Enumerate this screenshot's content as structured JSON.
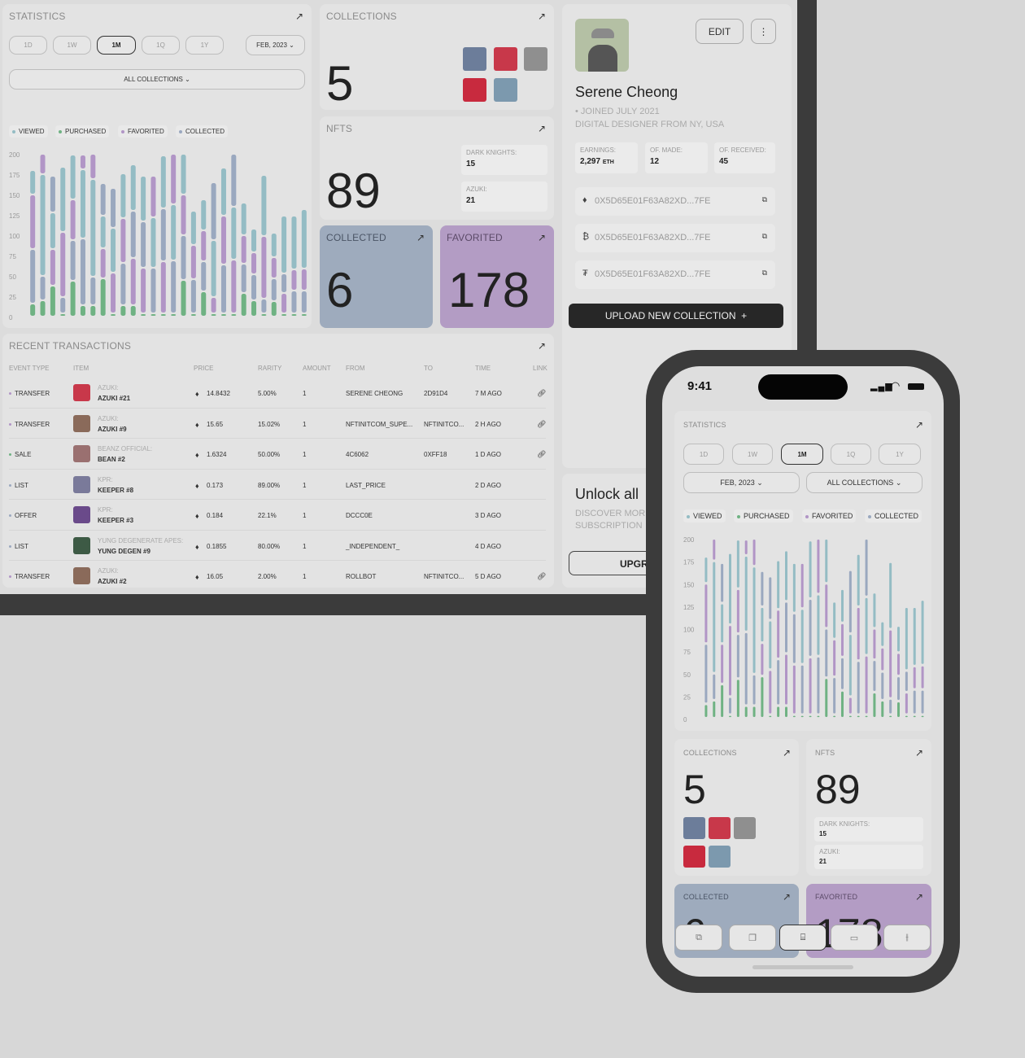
{
  "colors": {
    "viewed": "#94bcc4",
    "purchased": "#6fb283",
    "favorited": "#b195c6",
    "collected": "#9aa8bf",
    "collected_card": "#9eabbd",
    "favorited_card": "#b39cc4"
  },
  "statistics": {
    "title": "STATISTICS",
    "ranges": [
      "1D",
      "1W",
      "1M",
      "1Q",
      "1Y"
    ],
    "selected_range": "1M",
    "month": "FEB, 2023",
    "collection_filter": "ALL COLLECTIONS",
    "legend": [
      "VIEWED",
      "PURCHASED",
      "FAVORITED",
      "COLLECTED"
    ]
  },
  "collections": {
    "title": "COLLECTIONS",
    "count": "5"
  },
  "nfts": {
    "title": "NFTS",
    "count": "89",
    "breakdown": [
      {
        "label": "DARK KNIGHTS:",
        "value": "15"
      },
      {
        "label": "AZUKI:",
        "value": "21"
      }
    ]
  },
  "collected": {
    "title": "COLLECTED",
    "count": "6"
  },
  "favorited": {
    "title": "FAVORITED",
    "count": "178"
  },
  "profile": {
    "name": "Serene Cheong",
    "joined": "JOINED JULY 2021",
    "bio": "DIGITAL DESIGNER FROM NY, USA",
    "edit": "EDIT",
    "more_icon": "⋮",
    "stats": [
      {
        "label": "EARNINGS:",
        "value": "2,297",
        "unit": "ETH"
      },
      {
        "label": "OF. MADE:",
        "value": "12"
      },
      {
        "label": "OF. RECEIVED:",
        "value": "45"
      }
    ],
    "wallets": [
      {
        "icon": "ethereum-icon",
        "glyph": "♦",
        "address": "0X5D65E01F63A82XD...7FE"
      },
      {
        "icon": "bitcoin-icon",
        "glyph": "₿",
        "address": "0X5D65E01F63A82XD...7FE"
      },
      {
        "icon": "tether-icon",
        "glyph": "₮",
        "address": "0X5D65E01F63A82XD...7FE"
      }
    ],
    "upload": "UPLOAD NEW COLLECTION  +"
  },
  "unlock": {
    "title": "Unlock all",
    "text1": "DISCOVER MOR",
    "text2": "SUBSCRIPTION",
    "button": "UPGR"
  },
  "transactions": {
    "title": "RECENT TRANSACTIONS",
    "headers": [
      "EVENT TYPE",
      "ITEM",
      "PRICE",
      "RARITY",
      "AMOUNT",
      "FROM",
      "TO",
      "TIME",
      "LINK"
    ],
    "rows": [
      {
        "event": "TRANSFER",
        "collection": "AZUKI:",
        "item": "AZUKI #21",
        "price": "14.8432",
        "rarity": "5.00%",
        "amount": "1",
        "from": "SERENE CHEONG",
        "to": "2D91D4",
        "time": "7 M AGO",
        "link": true,
        "dot": "#b195c6",
        "thumb": "#c8384a"
      },
      {
        "event": "TRANSFER",
        "collection": "AZUKI:",
        "item": "AZUKI #9",
        "price": "15.65",
        "rarity": "15.02%",
        "amount": "1",
        "from": "NFTINITCOM_SUPE...",
        "to": "NFTINITCO...",
        "time": "2 H AGO",
        "link": true,
        "dot": "#b195c6",
        "thumb": "#8a6a5a"
      },
      {
        "event": "SALE",
        "collection": "BEANZ OFFICIAL:",
        "item": "BEAN #2",
        "price": "1.6324",
        "rarity": "50.00%",
        "amount": "1",
        "from": "4C6062",
        "to": "0XFF18",
        "time": "1 D AGO",
        "link": true,
        "dot": "#6fb283",
        "thumb": "#9a7070"
      },
      {
        "event": "LIST",
        "collection": "KPR:",
        "item": "KEEPER #8",
        "price": "0.173",
        "rarity": "89.00%",
        "amount": "1",
        "from": "LAST_PRICE",
        "to": "",
        "time": "2 D AGO",
        "link": false,
        "dot": "#9aa8bf",
        "thumb": "#7a7a9a"
      },
      {
        "event": "OFFER",
        "collection": "KPR:",
        "item": "KEEPER #3",
        "price": "0.184",
        "rarity": "22.1%",
        "amount": "1",
        "from": "DCCC0E",
        "to": "",
        "time": "3 D AGO",
        "link": false,
        "dot": "#9aa8bf",
        "thumb": "#6a4a8a"
      },
      {
        "event": "LIST",
        "collection": "YUNG DEGENERATE APES:",
        "item": "YUNG DEGEN #9",
        "price": "0.1855",
        "rarity": "80.00%",
        "amount": "1",
        "from": "_INDEPENDENT_",
        "to": "",
        "time": "4 D AGO",
        "link": false,
        "dot": "#9aa8bf",
        "thumb": "#3d5a45"
      },
      {
        "event": "TRANSFER",
        "collection": "AZUKI:",
        "item": "AZUKI #2",
        "price": "16.05",
        "rarity": "2.00%",
        "amount": "1",
        "from": "ROLLBOT",
        "to": "NFTINITCO...",
        "time": "5 D AGO",
        "link": true,
        "dot": "#b195c6",
        "thumb": "#8a6a5a"
      }
    ]
  },
  "phone": {
    "time": "9:41",
    "nav_icons": [
      "cards-icon",
      "copy-icon",
      "store-icon",
      "folder-icon",
      "sliders-icon"
    ],
    "selected_nav": "store-icon"
  },
  "chart_data": {
    "type": "bar",
    "stacked": true,
    "ylim": [
      0,
      200
    ],
    "yticks": [
      0,
      25,
      50,
      75,
      100,
      125,
      150,
      175,
      200
    ],
    "grid": false,
    "legend_position": "top-left",
    "series": [
      "viewed",
      "purchased",
      "favorited",
      "collected"
    ],
    "series_labels": {
      "viewed": "VIEWED",
      "purchased": "PURCHASED",
      "favorited": "FAVORITED",
      "collected": "COLLECTED"
    },
    "stacks": [
      [
        [
          "purchased",
          16
        ],
        [
          "collected",
          67
        ],
        [
          "favorited",
          67
        ],
        [
          "viewed",
          30
        ]
      ],
      [
        [
          "purchased",
          20
        ],
        [
          "collected",
          30
        ],
        [
          "viewed",
          125
        ],
        [
          "favorited",
          25
        ]
      ],
      [
        [
          "purchased",
          38
        ],
        [
          "favorited",
          45
        ],
        [
          "viewed",
          45
        ],
        [
          "collected",
          45
        ]
      ],
      [
        [
          "purchased",
          4
        ],
        [
          "collected",
          20
        ],
        [
          "favorited",
          80
        ],
        [
          "viewed",
          80
        ]
      ],
      [
        [
          "purchased",
          44
        ],
        [
          "collected",
          50
        ],
        [
          "favorited",
          50
        ],
        [
          "viewed",
          55
        ]
      ],
      [
        [
          "purchased",
          14
        ],
        [
          "collected",
          82
        ],
        [
          "viewed",
          85
        ],
        [
          "favorited",
          18
        ]
      ],
      [
        [
          "purchased",
          14
        ],
        [
          "collected",
          35
        ],
        [
          "viewed",
          120
        ],
        [
          "favorited",
          31
        ]
      ],
      [
        [
          "purchased",
          47
        ],
        [
          "favorited",
          37
        ],
        [
          "viewed",
          40
        ],
        [
          "collected",
          40
        ]
      ],
      [
        [
          "purchased",
          4
        ],
        [
          "favorited",
          50
        ],
        [
          "viewed",
          55
        ],
        [
          "collected",
          49
        ]
      ],
      [
        [
          "purchased",
          14
        ],
        [
          "collected",
          52
        ],
        [
          "favorited",
          55
        ],
        [
          "viewed",
          55
        ]
      ],
      [
        [
          "purchased",
          14
        ],
        [
          "favorited",
          58
        ],
        [
          "collected",
          58
        ],
        [
          "viewed",
          57
        ]
      ],
      [
        [
          "purchased",
          4
        ],
        [
          "favorited",
          56
        ],
        [
          "collected",
          57
        ],
        [
          "viewed",
          56
        ]
      ],
      [
        [
          "purchased",
          4
        ],
        [
          "collected",
          56
        ],
        [
          "viewed",
          62
        ],
        [
          "favorited",
          51
        ]
      ],
      [
        [
          "purchased",
          4
        ],
        [
          "favorited",
          64
        ],
        [
          "collected",
          65
        ],
        [
          "viewed",
          65
        ]
      ],
      [
        [
          "purchased",
          4
        ],
        [
          "collected",
          65
        ],
        [
          "viewed",
          69
        ],
        [
          "favorited",
          62
        ]
      ],
      [
        [
          "purchased",
          45
        ],
        [
          "collected",
          55
        ],
        [
          "favorited",
          50
        ],
        [
          "viewed",
          50
        ]
      ],
      [
        [
          "purchased",
          4
        ],
        [
          "collected",
          42
        ],
        [
          "favorited",
          42
        ],
        [
          "viewed",
          42
        ]
      ],
      [
        [
          "purchased",
          31
        ],
        [
          "collected",
          37
        ],
        [
          "favorited",
          38
        ],
        [
          "viewed",
          38
        ]
      ],
      [
        [
          "purchased",
          4
        ],
        [
          "favorited",
          20
        ],
        [
          "viewed",
          70
        ],
        [
          "collected",
          71
        ]
      ],
      [
        [
          "purchased",
          4
        ],
        [
          "collected",
          60
        ],
        [
          "favorited",
          60
        ],
        [
          "viewed",
          59
        ]
      ],
      [
        [
          "purchased",
          4
        ],
        [
          "favorited",
          66
        ],
        [
          "viewed",
          65
        ],
        [
          "collected",
          65
        ]
      ],
      [
        [
          "purchased",
          29
        ],
        [
          "collected",
          36
        ],
        [
          "favorited",
          35
        ],
        [
          "viewed",
          40
        ]
      ],
      [
        [
          "purchased",
          20
        ],
        [
          "collected",
          32
        ],
        [
          "favorited",
          27
        ],
        [
          "viewed",
          29
        ]
      ],
      [
        [
          "purchased",
          4
        ],
        [
          "collected",
          18
        ],
        [
          "favorited",
          77
        ],
        [
          "viewed",
          75
        ]
      ],
      [
        [
          "purchased",
          19
        ],
        [
          "collected",
          28
        ],
        [
          "favorited",
          26
        ],
        [
          "viewed",
          30
        ]
      ],
      [
        [
          "purchased",
          4
        ],
        [
          "favorited",
          25
        ],
        [
          "collected",
          24
        ],
        [
          "viewed",
          71
        ]
      ],
      [
        [
          "purchased",
          4
        ],
        [
          "collected",
          28
        ],
        [
          "favorited",
          26
        ],
        [
          "viewed",
          66
        ]
      ],
      [
        [
          "purchased",
          4
        ],
        [
          "collected",
          28
        ],
        [
          "favorited",
          27
        ],
        [
          "viewed",
          73
        ]
      ]
    ]
  }
}
